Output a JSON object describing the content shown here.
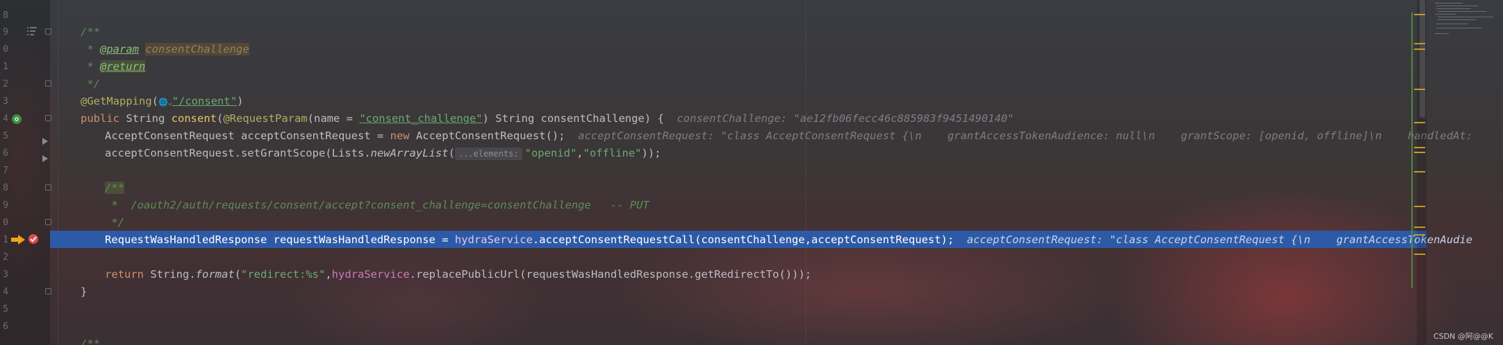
{
  "editor": {
    "line_numbers": [
      "8",
      "9",
      "0",
      "1",
      "2",
      "3",
      "4",
      "5",
      "6",
      "7",
      "8",
      "9",
      "0",
      "1",
      "2",
      "3",
      "4",
      "5",
      "6"
    ],
    "lines": {
      "l1_doc_open": "/**",
      "l2_star": " * ",
      "l2_tag": "@param",
      "l2_param": "consentChallenge",
      "l3_star": " * ",
      "l3_tag": "@return",
      "l4_doc_close": " */",
      "l5_ann": "@GetMapping",
      "l5_paren_open": "(",
      "l5_globe": "🌐",
      "l5_path": "\"/consent\"",
      "l5_paren_close": ")",
      "l6_public": "public",
      "l6_type": " String ",
      "l6_fn": "consent",
      "l6_paren": "(",
      "l6_ann": "@RequestParam",
      "l6_name": "(name = ",
      "l6_str": "\"consent_challenge\"",
      "l6_rest": ") String consentChallenge) {",
      "l6_hint": "consentChallenge: \"ae12fb06fecc46c885983f9451490140\"",
      "l7_code1": "AcceptConsentRequest acceptConsentRequest = ",
      "l7_new": "new",
      "l7_code2": " AcceptConsentRequest();",
      "l7_hint": "acceptConsentRequest: \"class AcceptConsentRequest {\\n    grantAccessTokenAudience: null\\n    grantScope: [openid, offline]\\n    handledAt:",
      "l8_code1": "acceptConsentRequest.setGrantScope(Lists.",
      "l8_fn": "newArrayList",
      "l8_paren": "(",
      "l8_inlay": "...elements:",
      "l8_str1": "\"openid\"",
      "l8_comma": ",",
      "l8_str2": "\"offline\"",
      "l8_close": "));",
      "l10_doc_open": "/**",
      "l11_comment": " *  /oauth2/auth/requests/consent/accept?consent_challenge=consentChallenge   -- PUT",
      "l12_doc_close": " */",
      "l13_code1": "RequestWasHandledResponse requestWasHandledResponse = ",
      "l13_field": "hydraService",
      "l13_code2": ".acceptConsentRequestCall(consentChallenge,acceptConsentRequest);",
      "l13_hint": "acceptConsentRequest: \"class AcceptConsentRequest {\\n    grantAccessTokenAudie",
      "l15_return": "return",
      "l15_code1": " String.",
      "l15_fn": "format",
      "l15_paren": "(",
      "l15_str": "\"redirect:%s\"",
      "l15_comma": ",",
      "l15_field": "hydraService",
      "l15_code2": ".replacePublicUrl(requestWasHandledResponse.getRedirectTo()));",
      "l16_brace": "}",
      "l19_doc_open": "/**"
    }
  },
  "watermark": "CSDN @阿@@K",
  "colors": {
    "highlight": "#2d5aa6",
    "keyword": "#cf8e6d",
    "string": "#6aab73",
    "doc_comment": "#5f8c57",
    "annotation": "#b3ae60"
  },
  "icons": {
    "debug_execution_point": "debug-arrow-icon",
    "breakpoint": "breakpoint-icon",
    "bean": "spring-bean-icon"
  }
}
